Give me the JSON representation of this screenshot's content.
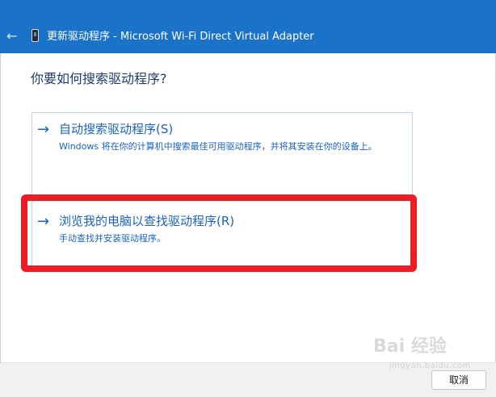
{
  "window": {
    "back_icon": "←",
    "title": "更新驱动程序 - Microsoft Wi-Fi Direct Virtual Adapter",
    "title_bar_color": "#1a73c9"
  },
  "main": {
    "heading": "你要如何搜索驱动程序?",
    "options": [
      {
        "arrow": "→",
        "title": "自动搜索驱动程序(S)",
        "description": "Windows 将在你的计算机中搜索最佳可用驱动程序，并将其安装在你的设备上。"
      },
      {
        "arrow": "→",
        "title": "浏览我的电脑以查找驱动程序(R)",
        "description": "手动查找并安装驱动程序。"
      }
    ],
    "highlight_color": "#ee1c25",
    "link_color": "#1a63c2"
  },
  "footer": {
    "cancel_label": "取消"
  },
  "watermark": {
    "brand": "Bai  经验",
    "url": "jingyan.baidu.com"
  }
}
